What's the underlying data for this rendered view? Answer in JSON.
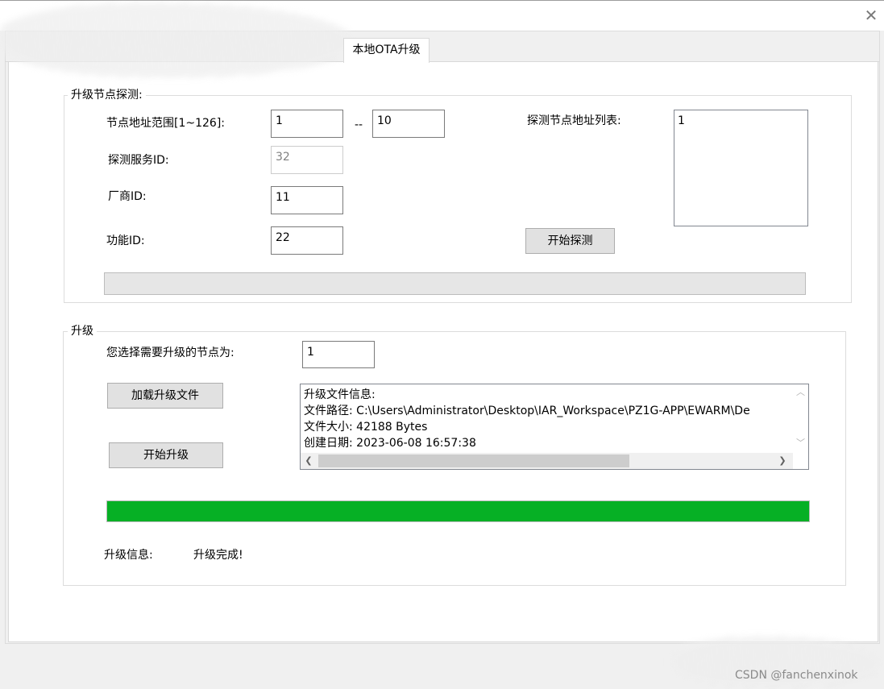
{
  "window": {
    "close_glyph": "✕"
  },
  "tab": {
    "label": "本地OTA升级"
  },
  "detect": {
    "group_title": "升级节点探测:",
    "addr_range_label": "节点地址范围[1~126]:",
    "addr_from": "1",
    "addr_sep": "--",
    "addr_to": "10",
    "service_id_label": "探测服务ID:",
    "service_id": "32",
    "vendor_id_label": "厂商ID:",
    "vendor_id": "11",
    "function_id_label": "功能ID:",
    "function_id": "22",
    "list_label": "探测节点地址列表:",
    "list_items": [
      "1"
    ],
    "start_button": "开始探测",
    "progress": 0
  },
  "upgrade": {
    "group_title": "升级",
    "node_label": "您选择需要升级的节点为:",
    "node_value": "1",
    "load_button": "加载升级文件",
    "start_button": "开始升级",
    "file_info": [
      "升级文件信息:",
      "文件路径:  C:\\Users\\Administrator\\Desktop\\IAR_Workspace\\PZ1G-APP\\EWARM\\De",
      "文件大小:  42188 Bytes",
      "创建日期:  2023-06-08 16:57:38"
    ],
    "progress": 1.0,
    "progress_color": "#06b025",
    "status_label": "升级信息:",
    "status_value": "升级完成!"
  },
  "watermark": "CSDN @fanchenxinok"
}
